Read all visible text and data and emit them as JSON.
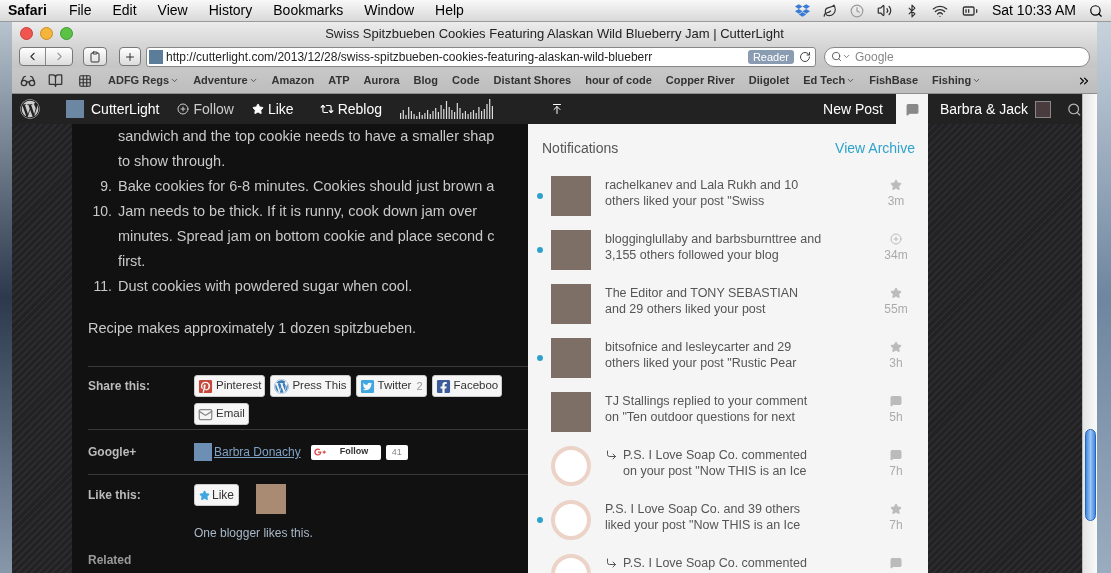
{
  "menu_bar": {
    "app": "Safari",
    "menus": [
      "File",
      "Edit",
      "View",
      "History",
      "Bookmarks",
      "Window",
      "Help"
    ],
    "clock": "Sat 10:33 AM"
  },
  "window": {
    "title": "Swiss Spitzbueben Cookies Featuring Alaskan Wild Blueberry Jam | CutterLight"
  },
  "toolbar": {
    "url": "http://cutterlight.com/2013/12/28/swiss-spitzbueben-cookies-featuring-alaskan-wild-blueberr",
    "reader": "Reader",
    "search": {
      "placeholder": "Google"
    }
  },
  "bookmarks": [
    {
      "label": "ADFG Regs",
      "menu": true
    },
    {
      "label": "Adventure",
      "menu": true
    },
    {
      "label": "Amazon",
      "menu": false
    },
    {
      "label": "ATP",
      "menu": false
    },
    {
      "label": "Aurora",
      "menu": false
    },
    {
      "label": "Blog",
      "menu": false
    },
    {
      "label": "Code",
      "menu": false
    },
    {
      "label": "Distant Shores",
      "menu": false
    },
    {
      "label": "hour of code",
      "menu": false
    },
    {
      "label": "Copper River",
      "menu": false
    },
    {
      "label": "Diigolet",
      "menu": false
    },
    {
      "label": "Ed Tech",
      "menu": true
    },
    {
      "label": "FishBase",
      "menu": false
    },
    {
      "label": "Fishing",
      "menu": true
    }
  ],
  "admin_bar": {
    "site": "CutterLight",
    "follow": "Follow",
    "like": "Like",
    "reblog": "Reblog",
    "new_post": "New Post",
    "notifications_open": true,
    "user": "Barbra & Jack"
  },
  "post": {
    "list": [
      {
        "lines": [
          "sandwich and the top cookie needs to have a smaller shap",
          "to show through."
        ]
      },
      {
        "number": "9.",
        "lines": [
          "Bake cookies for 6-8 minutes. Cookies should just brown a"
        ]
      },
      {
        "number": "10.",
        "lines": [
          "Jam needs to be thick. If it is runny, cook down jam over",
          "minutes. Spread jam on bottom cookie and place second c",
          "first."
        ]
      },
      {
        "number": "11.",
        "lines": [
          "Dust cookies with powdered sugar when cool."
        ]
      }
    ],
    "note": "Recipe makes approximately 1 dozen spitzbueben."
  },
  "share": {
    "label": "Share this:",
    "buttons": [
      {
        "kind": "pinterest",
        "label": "Pinterest"
      },
      {
        "kind": "wordpress",
        "label": "Press This"
      },
      {
        "kind": "twitter",
        "label": "Twitter",
        "count": "2"
      },
      {
        "kind": "facebook",
        "label": "Faceboo"
      },
      {
        "kind": "email",
        "label": "Email"
      }
    ]
  },
  "google_plus": {
    "label": "Google+",
    "name": "Barbra Donachy",
    "follow": "Follow",
    "count": "41"
  },
  "likes": {
    "label": "Like this:",
    "button": "Like",
    "summary": "One blogger likes this."
  },
  "related": "Related",
  "notifications": {
    "title": "Notifications",
    "archive": "View Archive",
    "items": [
      {
        "kind": "like",
        "unread": true,
        "reply": false,
        "avatar": {
          "kind": "photo"
        },
        "lines": [
          "rachelkanev and Lala Rukh and 10",
          "others liked your post \"Swiss"
        ],
        "time": "3m"
      },
      {
        "kind": "follow",
        "unread": true,
        "reply": false,
        "avatar": {
          "kind": "photo"
        },
        "lines": [
          "blogginglullaby and barbsburnttree and",
          "3,155 others followed your blog"
        ],
        "time": "34m"
      },
      {
        "kind": "like",
        "unread": false,
        "reply": false,
        "avatar": {
          "kind": "photo"
        },
        "lines": [
          "The Editor and TONY SEBASTIAN",
          "and 29 others liked your post"
        ],
        "time": "55m"
      },
      {
        "kind": "like",
        "unread": true,
        "reply": false,
        "avatar": {
          "kind": "photo"
        },
        "lines": [
          "bitsofnice and lesleycarter and 29",
          "others liked your post \"Rustic Pear"
        ],
        "time": "3h"
      },
      {
        "kind": "comment",
        "unread": false,
        "reply": false,
        "avatar": {
          "kind": "photo"
        },
        "lines": [
          "TJ Stallings replied to your comment",
          "on \"Ten outdoor questions for next"
        ],
        "time": "5h"
      },
      {
        "kind": "comment",
        "unread": false,
        "reply": true,
        "avatar": {
          "kind": "badge"
        },
        "lines": [
          "P.S. I Love Soap Co. commented",
          "on your post \"Now THIS is an Ice"
        ],
        "time": "7h"
      },
      {
        "kind": "like",
        "unread": true,
        "reply": false,
        "avatar": {
          "kind": "badge"
        },
        "lines": [
          "P.S. I Love Soap Co. and 39 others",
          "liked your post \"Now THIS is an Ice"
        ],
        "time": "7h"
      },
      {
        "kind": "comment",
        "unread": false,
        "reply": true,
        "avatar": {
          "kind": "badge"
        },
        "lines": [
          "P.S. I Love Soap Co. commented"
        ]
      }
    ]
  }
}
